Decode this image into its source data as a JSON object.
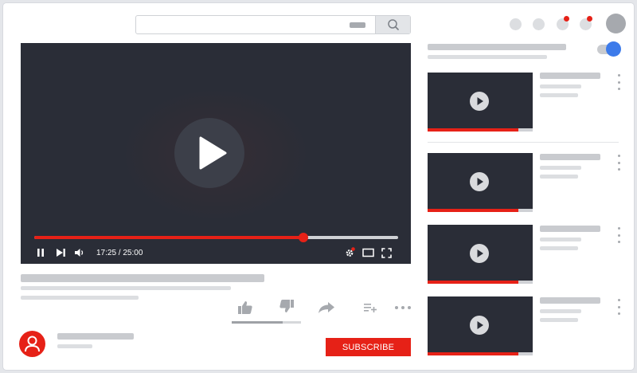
{
  "header": {
    "search": {
      "value": "",
      "placeholder": ""
    },
    "icons": [
      "search-icon",
      "apps-icon",
      "messages-icon",
      "notifications-icon",
      "alerts-icon",
      "account-avatar"
    ]
  },
  "player": {
    "state": "paused",
    "time_display": "17:25 / 25:00",
    "progress_fraction": 0.74,
    "icons": [
      "play-icon",
      "pause-icon",
      "next-icon",
      "volume-icon",
      "settings-icon",
      "theater-mode-icon",
      "fullscreen-icon"
    ]
  },
  "actions": {
    "icons": [
      "like-icon",
      "dislike-icon",
      "share-icon",
      "add-to-playlist-icon",
      "more-icon"
    ],
    "like_ratio": 0.74
  },
  "channel": {
    "subscribe_label": "SUBSCRIBE"
  },
  "sidebar": {
    "autoplay_on": true,
    "videos": [
      {
        "progress_fraction": 0.86
      },
      {
        "progress_fraction": 0.86
      },
      {
        "progress_fraction": 0.86
      },
      {
        "progress_fraction": 0.86
      }
    ]
  },
  "colors": {
    "accent": "#e62117",
    "player_bg": "#2a2d37",
    "toggle_on": "#3d7bea",
    "placeholder": "#c9cbcf"
  }
}
